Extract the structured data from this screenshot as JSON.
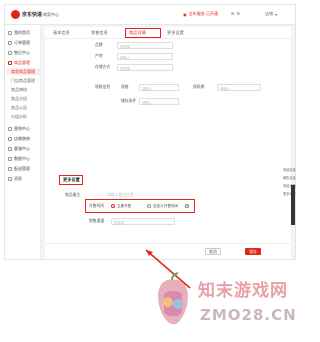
{
  "topbar": {
    "logo_text": "京东快递",
    "app_name": "商家中心",
    "notice": "全年服务 已开通",
    "user": "店铺"
  },
  "sidebar": {
    "items": [
      {
        "label": "我的首页"
      },
      {
        "label": "订单管理"
      },
      {
        "label": "售后中心"
      },
      {
        "label": "商品管理"
      },
      {
        "label": "营销中心"
      },
      {
        "label": "店铺装修"
      },
      {
        "label": "客服中心"
      },
      {
        "label": "数据中心"
      },
      {
        "label": "配送管理"
      },
      {
        "label": "消息"
      }
    ],
    "sub_items": [
      {
        "label": "商家商品管理",
        "active": true
      },
      {
        "label": "门店商品管理"
      },
      {
        "label": "商品审核"
      },
      {
        "label": "商品分组"
      },
      {
        "label": "商品公告"
      },
      {
        "label": "分组分析"
      }
    ]
  },
  "tabs": [
    {
      "label": "基本信息"
    },
    {
      "label": "销售信息"
    },
    {
      "label": "商品详情"
    },
    {
      "label": "更多设置"
    }
  ],
  "form": {
    "brand_label": "品牌",
    "brand_placeholder": "请选择",
    "area_label": "产地",
    "area_placeholder": "请输入",
    "storage_label": "存储方式",
    "storage_placeholder": "请选择",
    "spec_group_label": "规格信息",
    "spec_a_label": "规格",
    "spec_a_placeholder": "请输入",
    "spec_b_label": "保质期",
    "spec_b_placeholder": "请输入",
    "spec_c_label": "储存条件",
    "spec_c_placeholder": "请输入"
  },
  "more_settings": {
    "section_title": "更多设置",
    "note_label": "商品备注",
    "note_placeholder": "请输入备注信息",
    "sale_time_label": "开售时间",
    "option_a": "立即开售",
    "option_b": "自定义开售时间",
    "channel_label": "销售渠道",
    "channel_placeholder": "请选择"
  },
  "right_links": [
    "商品信息",
    "销售信息",
    "商品详情",
    "更多设置"
  ],
  "footer": {
    "cancel": "取消",
    "submit": "保存"
  },
  "watermark": {
    "text_cn": "知末游戏网",
    "text_en": "ZMO28.CN"
  },
  "colors": {
    "accent": "#e1251b",
    "highlight_box": "#e1251b",
    "page_bg": "#f2f4f7"
  }
}
